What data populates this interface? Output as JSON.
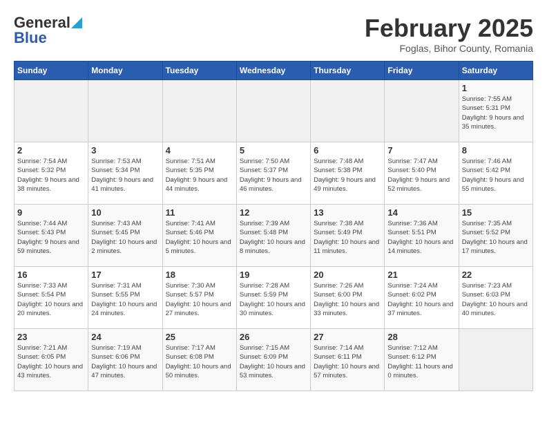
{
  "header": {
    "logo_general": "General",
    "logo_blue": "Blue",
    "month_title": "February 2025",
    "subtitle": "Foglas, Bihor County, Romania"
  },
  "days_of_week": [
    "Sunday",
    "Monday",
    "Tuesday",
    "Wednesday",
    "Thursday",
    "Friday",
    "Saturday"
  ],
  "weeks": [
    [
      {
        "day": "",
        "info": ""
      },
      {
        "day": "",
        "info": ""
      },
      {
        "day": "",
        "info": ""
      },
      {
        "day": "",
        "info": ""
      },
      {
        "day": "",
        "info": ""
      },
      {
        "day": "",
        "info": ""
      },
      {
        "day": "1",
        "info": "Sunrise: 7:55 AM\nSunset: 5:31 PM\nDaylight: 9 hours and 35 minutes."
      }
    ],
    [
      {
        "day": "2",
        "info": "Sunrise: 7:54 AM\nSunset: 5:32 PM\nDaylight: 9 hours and 38 minutes."
      },
      {
        "day": "3",
        "info": "Sunrise: 7:53 AM\nSunset: 5:34 PM\nDaylight: 9 hours and 41 minutes."
      },
      {
        "day": "4",
        "info": "Sunrise: 7:51 AM\nSunset: 5:35 PM\nDaylight: 9 hours and 44 minutes."
      },
      {
        "day": "5",
        "info": "Sunrise: 7:50 AM\nSunset: 5:37 PM\nDaylight: 9 hours and 46 minutes."
      },
      {
        "day": "6",
        "info": "Sunrise: 7:48 AM\nSunset: 5:38 PM\nDaylight: 9 hours and 49 minutes."
      },
      {
        "day": "7",
        "info": "Sunrise: 7:47 AM\nSunset: 5:40 PM\nDaylight: 9 hours and 52 minutes."
      },
      {
        "day": "8",
        "info": "Sunrise: 7:46 AM\nSunset: 5:42 PM\nDaylight: 9 hours and 55 minutes."
      }
    ],
    [
      {
        "day": "9",
        "info": "Sunrise: 7:44 AM\nSunset: 5:43 PM\nDaylight: 9 hours and 59 minutes."
      },
      {
        "day": "10",
        "info": "Sunrise: 7:43 AM\nSunset: 5:45 PM\nDaylight: 10 hours and 2 minutes."
      },
      {
        "day": "11",
        "info": "Sunrise: 7:41 AM\nSunset: 5:46 PM\nDaylight: 10 hours and 5 minutes."
      },
      {
        "day": "12",
        "info": "Sunrise: 7:39 AM\nSunset: 5:48 PM\nDaylight: 10 hours and 8 minutes."
      },
      {
        "day": "13",
        "info": "Sunrise: 7:38 AM\nSunset: 5:49 PM\nDaylight: 10 hours and 11 minutes."
      },
      {
        "day": "14",
        "info": "Sunrise: 7:36 AM\nSunset: 5:51 PM\nDaylight: 10 hours and 14 minutes."
      },
      {
        "day": "15",
        "info": "Sunrise: 7:35 AM\nSunset: 5:52 PM\nDaylight: 10 hours and 17 minutes."
      }
    ],
    [
      {
        "day": "16",
        "info": "Sunrise: 7:33 AM\nSunset: 5:54 PM\nDaylight: 10 hours and 20 minutes."
      },
      {
        "day": "17",
        "info": "Sunrise: 7:31 AM\nSunset: 5:55 PM\nDaylight: 10 hours and 24 minutes."
      },
      {
        "day": "18",
        "info": "Sunrise: 7:30 AM\nSunset: 5:57 PM\nDaylight: 10 hours and 27 minutes."
      },
      {
        "day": "19",
        "info": "Sunrise: 7:28 AM\nSunset: 5:59 PM\nDaylight: 10 hours and 30 minutes."
      },
      {
        "day": "20",
        "info": "Sunrise: 7:26 AM\nSunset: 6:00 PM\nDaylight: 10 hours and 33 minutes."
      },
      {
        "day": "21",
        "info": "Sunrise: 7:24 AM\nSunset: 6:02 PM\nDaylight: 10 hours and 37 minutes."
      },
      {
        "day": "22",
        "info": "Sunrise: 7:23 AM\nSunset: 6:03 PM\nDaylight: 10 hours and 40 minutes."
      }
    ],
    [
      {
        "day": "23",
        "info": "Sunrise: 7:21 AM\nSunset: 6:05 PM\nDaylight: 10 hours and 43 minutes."
      },
      {
        "day": "24",
        "info": "Sunrise: 7:19 AM\nSunset: 6:06 PM\nDaylight: 10 hours and 47 minutes."
      },
      {
        "day": "25",
        "info": "Sunrise: 7:17 AM\nSunset: 6:08 PM\nDaylight: 10 hours and 50 minutes."
      },
      {
        "day": "26",
        "info": "Sunrise: 7:15 AM\nSunset: 6:09 PM\nDaylight: 10 hours and 53 minutes."
      },
      {
        "day": "27",
        "info": "Sunrise: 7:14 AM\nSunset: 6:11 PM\nDaylight: 10 hours and 57 minutes."
      },
      {
        "day": "28",
        "info": "Sunrise: 7:12 AM\nSunset: 6:12 PM\nDaylight: 11 hours and 0 minutes."
      },
      {
        "day": "",
        "info": ""
      }
    ]
  ]
}
